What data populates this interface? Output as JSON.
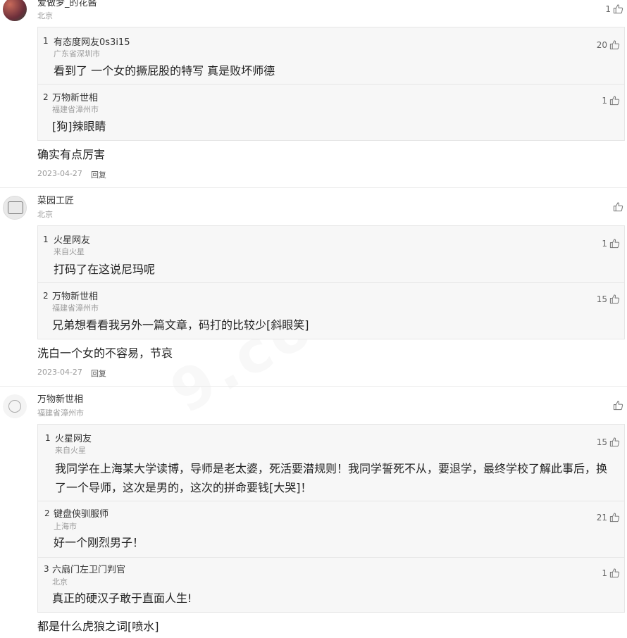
{
  "comments": [
    {
      "name": "爱做梦_的花酱",
      "location": "北京",
      "likes": "1",
      "replies": [
        {
          "index": "1",
          "name": "有态度网友0s3i15",
          "location": "广东省深圳市",
          "likes": "20",
          "text": "看到了 一个女的撅屁股的特写 真是败坏师德"
        },
        {
          "index": "2",
          "name": "万物新世相",
          "location": "福建省漳州市",
          "likes": "1",
          "text": "[狗]辣眼睛"
        }
      ],
      "text": "确实有点厉害",
      "date": "2023-04-27",
      "reply_label": "回复"
    },
    {
      "name": "菜园工匠",
      "location": "北京",
      "likes": "",
      "replies": [
        {
          "index": "1",
          "name": "火星网友",
          "location": "来自火星",
          "likes": "1",
          "text": "打码了在这说尼玛呢"
        },
        {
          "index": "2",
          "name": "万物新世相",
          "location": "福建省漳州市",
          "likes": "15",
          "text": "兄弟想看看我另外一篇文章，码打的比较少[斜眼笑]"
        }
      ],
      "text": "洗白一个女的不容易，节哀",
      "date": "2023-04-27",
      "reply_label": "回复"
    },
    {
      "name": "万物新世相",
      "location": "福建省漳州市",
      "likes": "",
      "replies": [
        {
          "index": "1",
          "name": "火星网友",
          "location": "来自火星",
          "likes": "15",
          "text": "我同学在上海某大学读博，导师是老太婆，死活要潜规则！我同学誓死不从，要退学，最终学校了解此事后，换了一个导师，这次是男的，这次的拼命要钱[大哭]！"
        },
        {
          "index": "2",
          "name": "键盘侠驯服师",
          "location": "上海市",
          "likes": "21",
          "text": "好一个刚烈男子！"
        },
        {
          "index": "3",
          "name": "六扇门左卫门判官",
          "location": "北京",
          "likes": "1",
          "text": "真正的硬汉子敢于直面人生!"
        }
      ],
      "text": "都是什么虎狼之词[喷水]"
    }
  ],
  "icons": {
    "like": "thumbs-up-icon"
  },
  "colors": {
    "text": "#222222",
    "meta": "#9a9a9a",
    "reply_bg": "#f7f7f7",
    "border": "#e6e6e6"
  }
}
